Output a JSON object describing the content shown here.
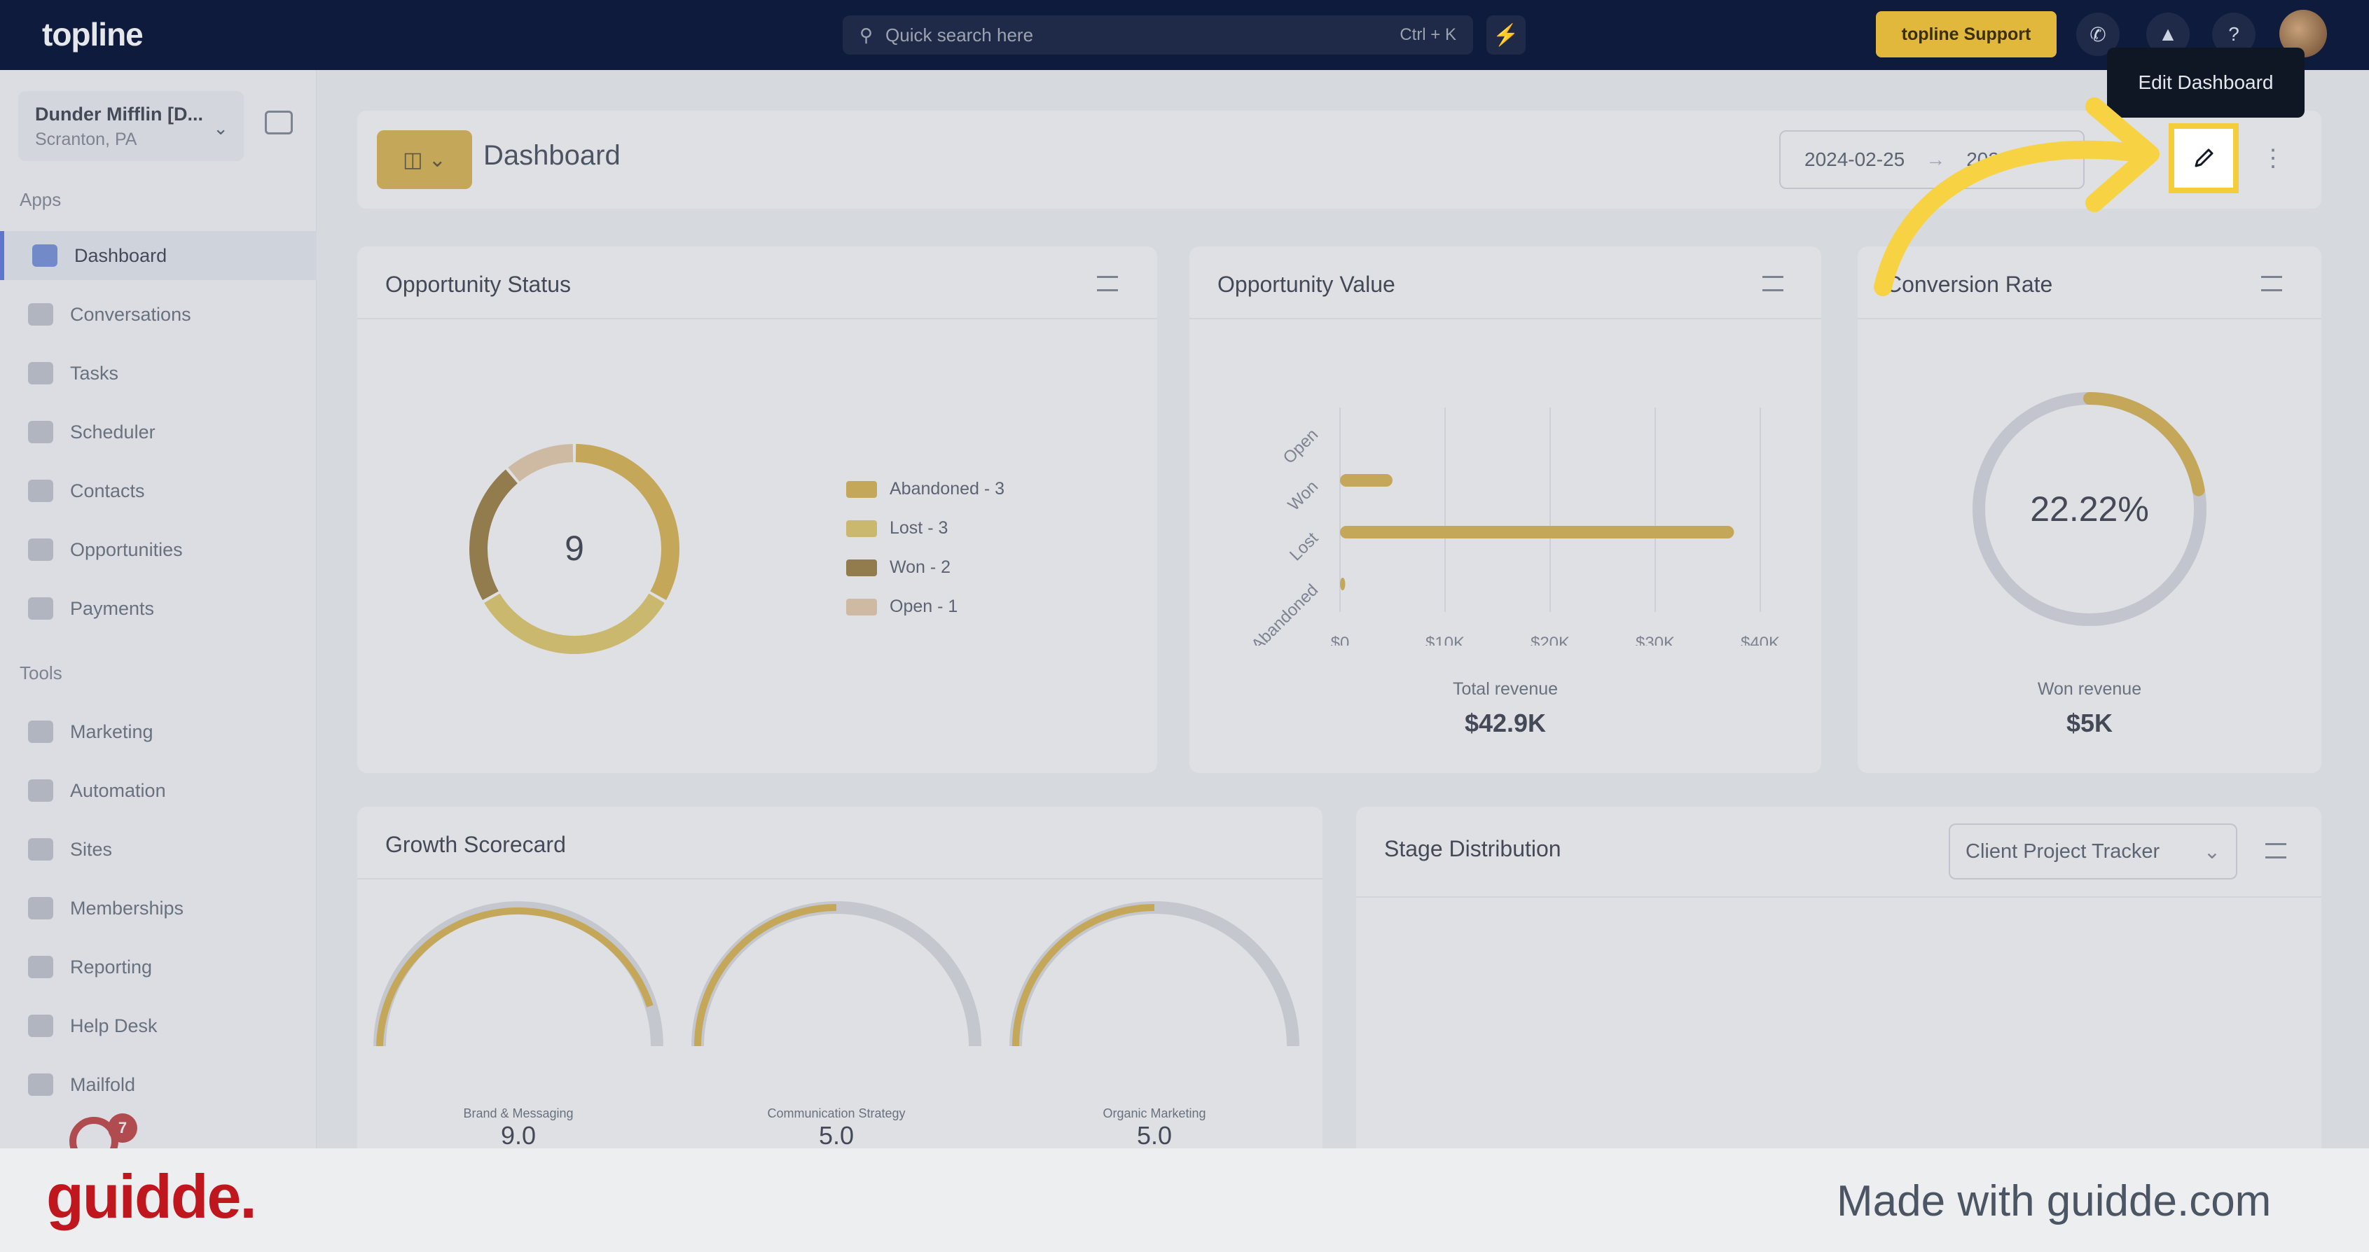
{
  "topbar": {
    "logo": "topline",
    "search_placeholder": "Quick search here",
    "search_shortcut": "Ctrl + K",
    "support_label": "topline Support"
  },
  "sidebar": {
    "account_name": "Dunder Mifflin [D...",
    "account_location": "Scranton, PA",
    "apps_heading": "Apps",
    "apps": [
      "Dashboard",
      "Conversations",
      "Tasks",
      "Scheduler",
      "Contacts",
      "Opportunities",
      "Payments"
    ],
    "tools_heading": "Tools",
    "tools": [
      "Marketing",
      "Automation",
      "Sites",
      "Memberships",
      "Reporting",
      "Help Desk",
      "Mailfold"
    ],
    "notification_count": "7"
  },
  "header": {
    "title": "Dashboard",
    "date_start": "2024-02-25",
    "date_end": "202",
    "tooltip": "Edit Dashboard"
  },
  "opportunity_status": {
    "title": "Opportunity Status",
    "total": "9",
    "legend": [
      "Abandoned - 3",
      "Lost - 3",
      "Won - 2",
      "Open - 1"
    ]
  },
  "opportunity_value": {
    "title": "Opportunity Value",
    "categories": [
      "Open",
      "Won",
      "Lost",
      "Abandoned"
    ],
    "x_ticks": [
      "$0",
      "$10K",
      "$20K",
      "$30K",
      "$40K"
    ],
    "total_label": "Total revenue",
    "total_value": "$42.9K"
  },
  "conversion_rate": {
    "title": "Conversion Rate",
    "percent": "22.22%",
    "won_label": "Won revenue",
    "won_value": "$5K"
  },
  "growth_scorecard": {
    "title": "Growth Scorecard",
    "gauges": [
      {
        "label": "Brand & Messaging",
        "value": "9.0",
        "min": "0",
        "max": "10"
      },
      {
        "label": "Communication Strategy",
        "value": "5.0",
        "min": "0",
        "max": "10"
      },
      {
        "label": "Organic Marketing",
        "value": "5.0",
        "min": "0",
        "max": "10"
      }
    ]
  },
  "stage_distribution": {
    "title": "Stage Distribution",
    "pipeline": "Client Project Tracker"
  },
  "footer": {
    "brand": "guidde.",
    "made_with": "Made with guidde.com"
  },
  "colors": {
    "accent": "#d9a82a",
    "nav_bg": "#0f1b3d",
    "highlight": "#f3cd3a"
  },
  "chart_data": [
    {
      "type": "pie",
      "title": "Opportunity Status",
      "categories": [
        "Abandoned",
        "Lost",
        "Won",
        "Open"
      ],
      "values": [
        3,
        3,
        2,
        1
      ],
      "colors": [
        "#d9a82a",
        "#e0c24a",
        "#8a6418",
        "#e6c59c"
      ]
    },
    {
      "type": "bar",
      "title": "Opportunity Value",
      "categories": [
        "Open",
        "Won",
        "Lost",
        "Abandoned"
      ],
      "values": [
        0,
        5000,
        37500,
        500
      ],
      "xlim": [
        0,
        40000
      ]
    },
    {
      "type": "pie",
      "title": "Conversion Rate",
      "categories": [
        "Won",
        "Other"
      ],
      "values": [
        22.22,
        77.78
      ]
    }
  ]
}
